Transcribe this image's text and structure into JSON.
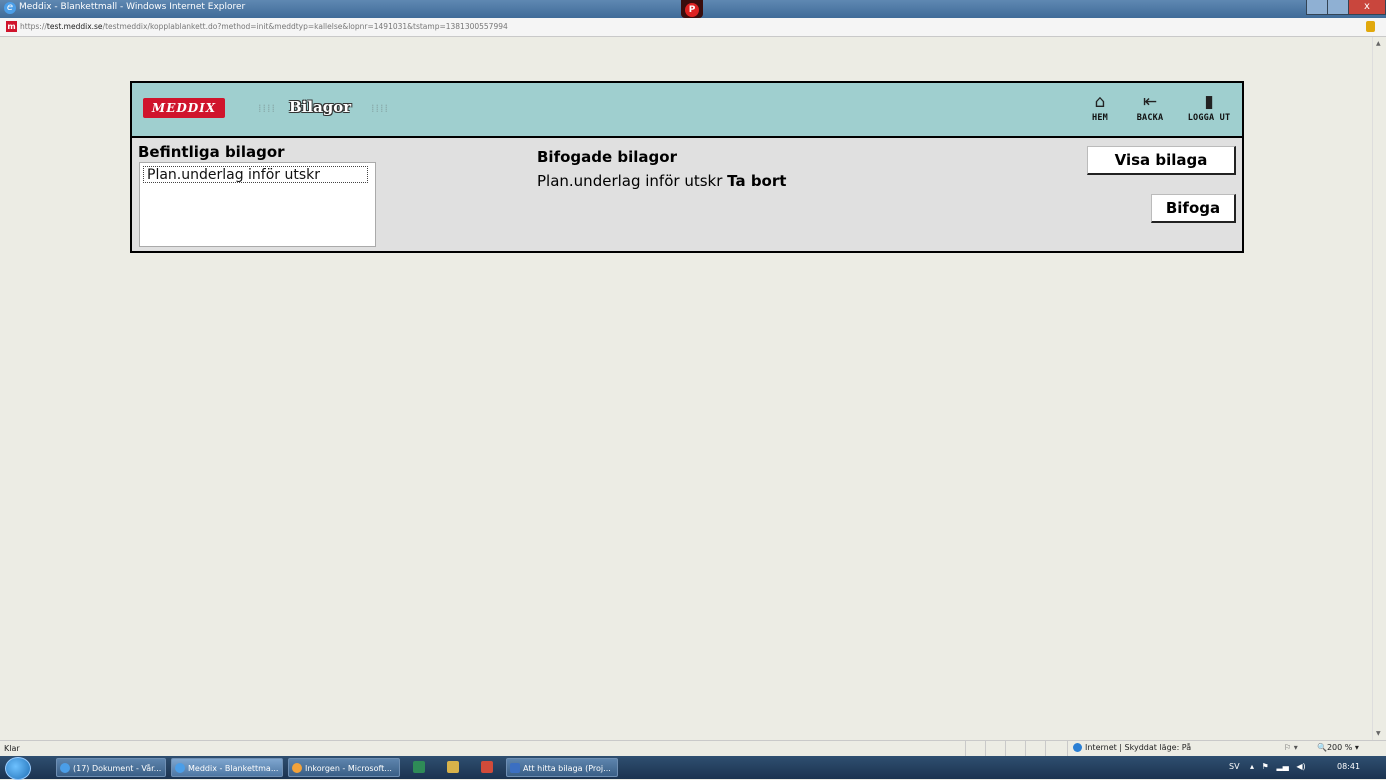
{
  "window": {
    "title": "Meddix - Blankettmall - Windows Internet Explorer",
    "close_glyph": "x"
  },
  "address": {
    "protocol": "https://",
    "host": "test.meddix.se",
    "path": "/testmeddix/kopplablankett.do?method=init&meddtyp=kallelse&lopnr=1491031&tstamp=1381300557994"
  },
  "header": {
    "logo": "MEDDIX",
    "title": "Bilagor",
    "nav": [
      {
        "label": "HEM",
        "icon": "home-icon"
      },
      {
        "label": "BACKA",
        "icon": "back-arrow-icon"
      },
      {
        "label": "LOGGA UT",
        "icon": "door-icon"
      }
    ]
  },
  "existing": {
    "heading": "Befintliga bilagor",
    "items": [
      "Plan.underlag inför utskr"
    ]
  },
  "attached": {
    "heading": "Bifogade bilagor",
    "item": "Plan.underlag inför utskr",
    "remove_label": "Ta bort"
  },
  "buttons": {
    "show": "Visa bilaga",
    "attach": "Bifoga"
  },
  "statusbar": {
    "status": "Klar",
    "zone": "Internet | Skyddat läge: På",
    "zoom": "200 %"
  },
  "taskbar": {
    "items": [
      {
        "label": "(17) Dokument - Vår..."
      },
      {
        "label": "Meddix - Blankettma..."
      },
      {
        "label": "Inkorgen - Microsoft..."
      },
      {
        "label": "Att hitta bilaga (Proj..."
      }
    ],
    "lang": "SV",
    "clock": "08:41"
  }
}
